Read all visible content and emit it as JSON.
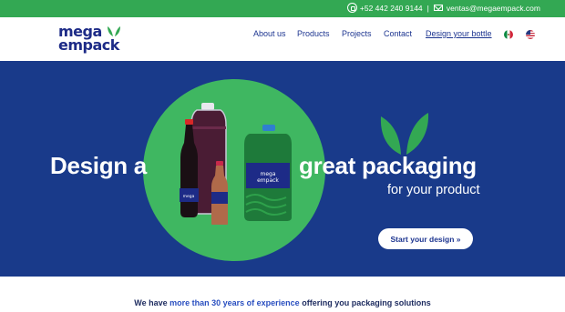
{
  "topbar": {
    "phone": "+52 442 240 9144",
    "separator": "|",
    "email": "ventas@megaempack.com",
    "phone_icon": "whatsapp-icon",
    "email_icon": "mail-icon",
    "bg_color": "#33a853"
  },
  "logo": {
    "line1": "mega",
    "line2": "empack",
    "mark_icon": "leaf-icon"
  },
  "nav": {
    "items": [
      "About us",
      "Products",
      "Projects",
      "Contact",
      "Design your bottle"
    ],
    "languages": [
      {
        "icon": "mexico-flag-icon"
      },
      {
        "icon": "usa-flag-icon"
      }
    ]
  },
  "hero": {
    "headline_left": "Design a",
    "headline_right": "great packaging",
    "subline": "for your product",
    "cta_label": "Start your design »",
    "bg_color": "#193a8a",
    "circle_color": "#3fb761",
    "bottle_label_1": "mega",
    "bottle_label_2": "empack",
    "decor_icon": "leaves-icon"
  },
  "tagline": {
    "before": "We have ",
    "highlight": "more than 30 years of experience",
    "after": " offering you packaging solutions"
  }
}
